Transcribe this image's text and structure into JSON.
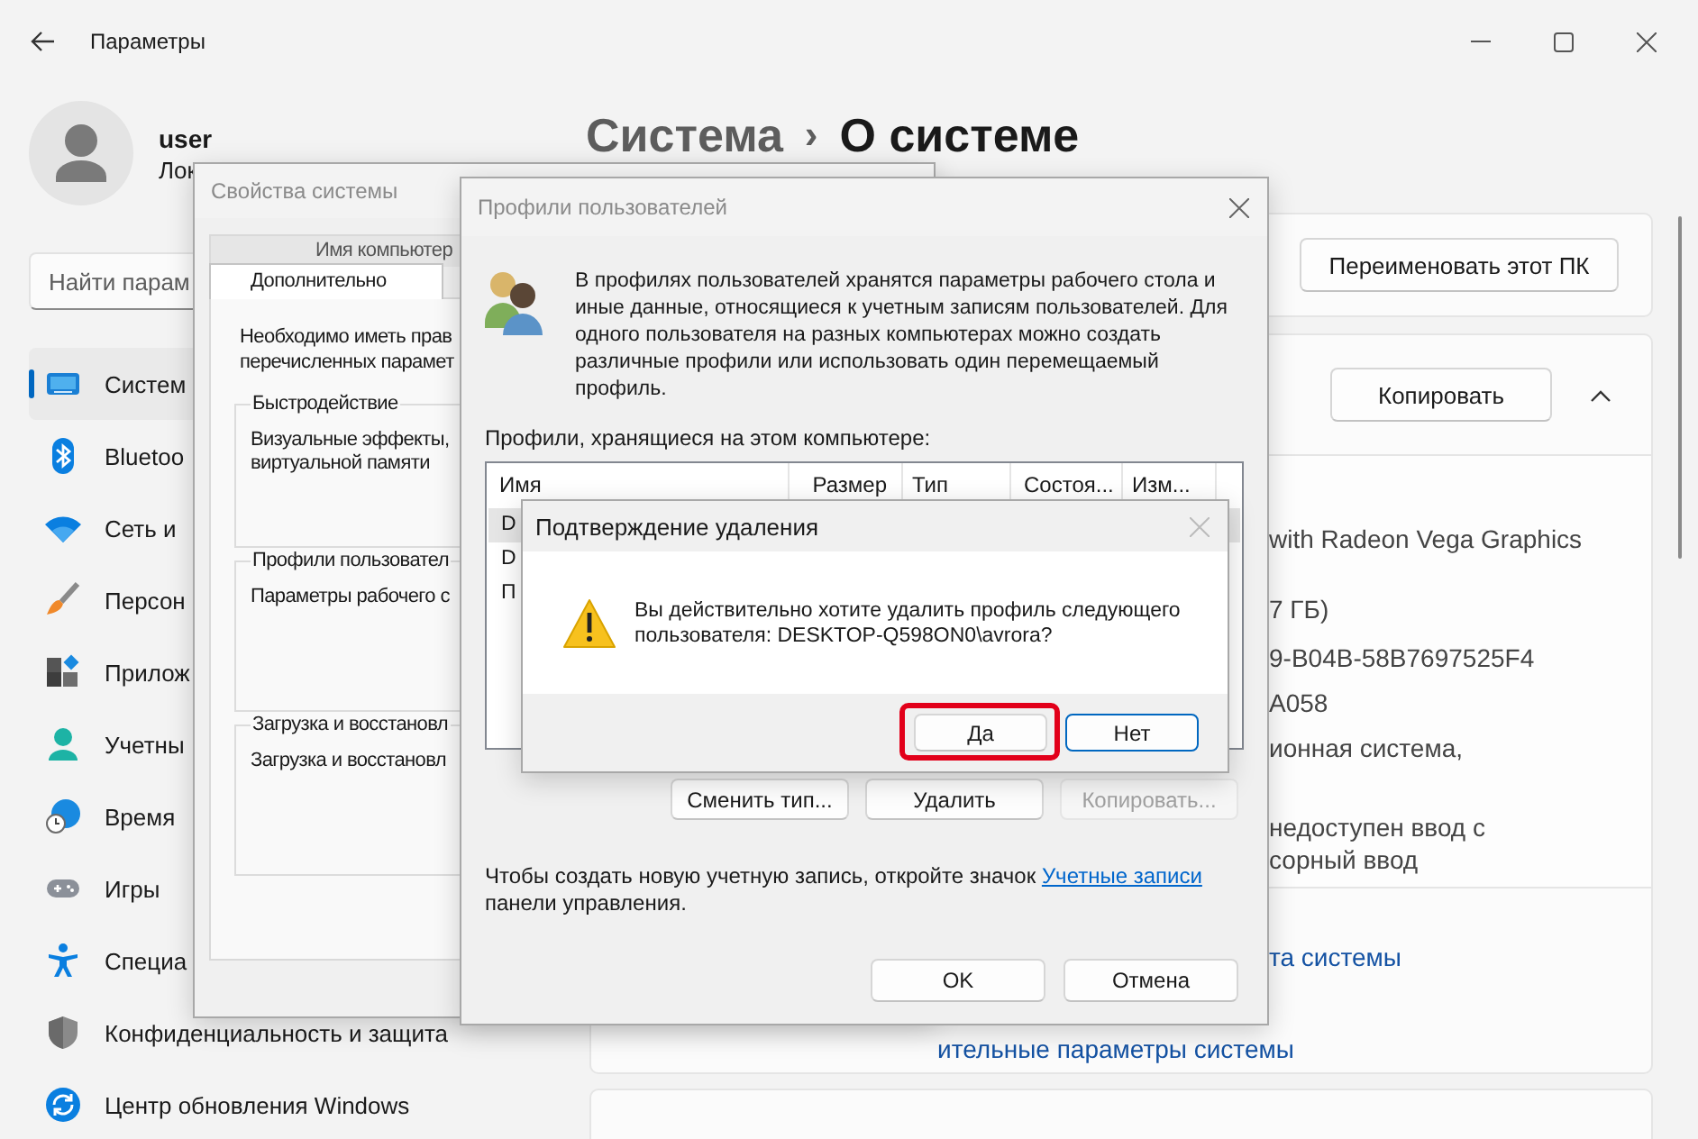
{
  "window": {
    "title": "Параметры"
  },
  "user": {
    "name": "user",
    "subtitle": "Лок"
  },
  "search": {
    "placeholder": "Найти парам"
  },
  "nav": [
    {
      "label": "Систем",
      "selected": true
    },
    {
      "label": "Bluetoo",
      "selected": false
    },
    {
      "label": "Сеть и",
      "selected": false
    },
    {
      "label": "Персон",
      "selected": false
    },
    {
      "label": "Прилож",
      "selected": false
    },
    {
      "label": "Учетны",
      "selected": false
    },
    {
      "label": "Время",
      "selected": false
    },
    {
      "label": "Игры",
      "selected": false
    },
    {
      "label": "Специа",
      "selected": false
    },
    {
      "label": "Конфиденциальность и защита",
      "selected": false
    },
    {
      "label": "Центр обновления Windows",
      "selected": false
    }
  ],
  "breadcrumb": {
    "parent": "Система",
    "separator": "›",
    "current": "О системе"
  },
  "rename_button": "Переименовать этот ПК",
  "specs": {
    "copy_button": "Копировать",
    "expanded": true,
    "values": [
      "with Radeon Vega Graphics",
      "7 ГБ)",
      "9-B04B-58B7697525F4",
      "A058",
      "ионная система,",
      "недоступен ввод с",
      "сорный ввод"
    ]
  },
  "links": [
    "та системы",
    "ительные параметры системы"
  ],
  "system_properties": {
    "title": "Свойства системы",
    "tabs": [
      {
        "label": "Имя компьютер",
        "selected": false
      },
      {
        "label": "Дополнительно",
        "selected": true
      }
    ],
    "intro": [
      "Необходимо иметь прав",
      "перечисленных парамет"
    ],
    "groups": [
      {
        "title": "Быстродействие",
        "lines": [
          "Визуальные эффекты,",
          "виртуальной памяти"
        ]
      },
      {
        "title": "Профили пользовател",
        "lines": [
          "Параметры рабочего с"
        ]
      },
      {
        "title": "Загрузка и восстановл",
        "lines": [
          "Загрузка и восстановл"
        ]
      }
    ]
  },
  "user_profiles": {
    "title": "Профили пользователей",
    "description": "В профилях пользователей хранятся параметры рабочего стола и иные данные, относящиеся к учетным записям пользователей. Для одного пользователя на разных компьютерах можно создать различные профили или использовать один перемещаемый профиль.",
    "list_label": "Профили, хранящиеся на этом компьютере:",
    "columns": [
      "Имя",
      "Размер",
      "Тип",
      "Состоя...",
      "Изм..."
    ],
    "rows": [
      {
        "name": "D",
        "selected": true
      },
      {
        "name": "D",
        "selected": false
      },
      {
        "name": "П",
        "selected": false
      }
    ],
    "buttons": [
      {
        "label": "Сменить тип...",
        "disabled": false
      },
      {
        "label": "Удалить",
        "disabled": false
      },
      {
        "label": "Копировать...",
        "disabled": true
      }
    ],
    "note": {
      "before": "Чтобы создать новую учетную запись, откройте значок ",
      "link": "Учетные записи",
      "after": " панели управления."
    },
    "footer_buttons": [
      "OK",
      "Отмена"
    ]
  },
  "confirm": {
    "title": "Подтверждение удаления",
    "message": "Вы действительно хотите удалить профиль следующего пользователя: DESKTOP-Q598ON0\\avrora?",
    "buttons": [
      {
        "label": "Да",
        "default": false,
        "highlighted": true
      },
      {
        "label": "Нет",
        "default": true,
        "highlighted": false
      }
    ]
  }
}
